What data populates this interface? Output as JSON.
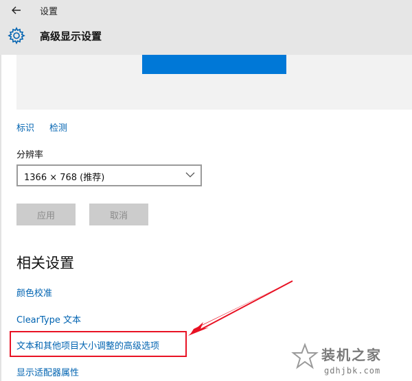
{
  "window": {
    "title": "设置",
    "back_icon": "back-arrow-icon"
  },
  "header": {
    "page_title": "高级显示设置",
    "icon": "gear-icon"
  },
  "display": {
    "identify_link": "标识",
    "detect_link": "检测",
    "resolution_label": "分辨率",
    "resolution_value": "1366 × 768 (推荐)"
  },
  "actions": {
    "apply_label": "应用",
    "cancel_label": "取消"
  },
  "related": {
    "title": "相关设置",
    "links": [
      "颜色校准",
      "ClearType 文本",
      "文本和其他项目大小调整的高级选项",
      "显示适配器属性"
    ]
  },
  "watermark": {
    "brand": "装机之家",
    "url": "gdhjbk.com"
  },
  "colors": {
    "accent": "#0078d7",
    "link": "#0063b1",
    "header_bg": "#e6e6e6",
    "annotation": "#e81123"
  }
}
